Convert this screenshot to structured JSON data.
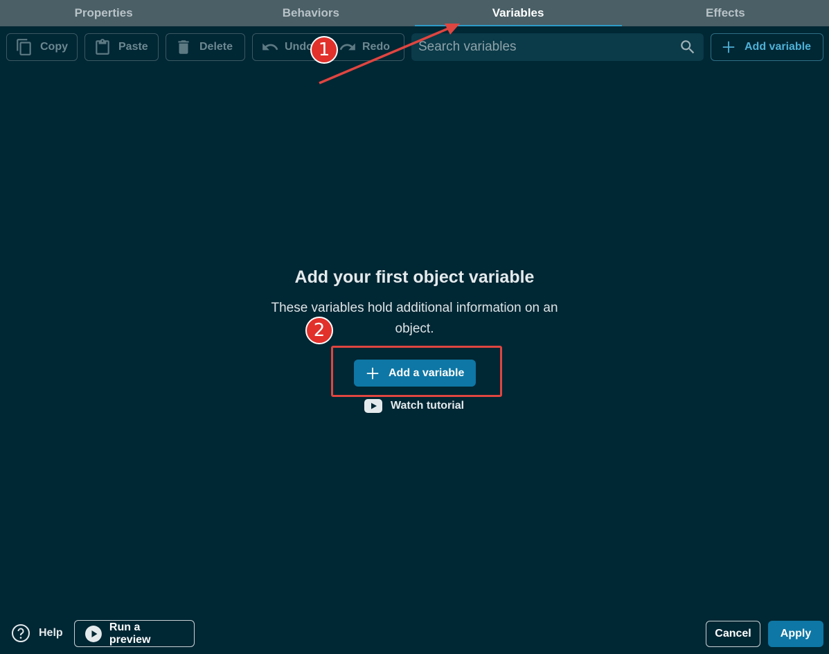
{
  "tabs": [
    {
      "label": "Properties",
      "active": false
    },
    {
      "label": "Behaviors",
      "active": false
    },
    {
      "label": "Variables",
      "active": true
    },
    {
      "label": "Effects",
      "active": false
    }
  ],
  "toolbar": {
    "copy_label": "Copy",
    "paste_label": "Paste",
    "delete_label": "Delete",
    "undo_label": "Undo",
    "redo_label": "Redo",
    "search_placeholder": "Search variables",
    "add_variable_label": "Add variable"
  },
  "empty_state": {
    "title": "Add your first object variable",
    "description": "These variables hold additional information on an object.",
    "add_button_label": "Add a variable",
    "tutorial_label": "Watch tutorial"
  },
  "annotations": {
    "step_1": "1",
    "step_2": "2"
  },
  "footer": {
    "help_label": "Help",
    "preview_label": "Run a preview",
    "cancel_label": "Cancel",
    "apply_label": "Apply"
  },
  "colors": {
    "background": "#002734",
    "tab_bar": "#4a5f66",
    "accent": "#0e77a5",
    "annotation_red": "#e2302b"
  }
}
